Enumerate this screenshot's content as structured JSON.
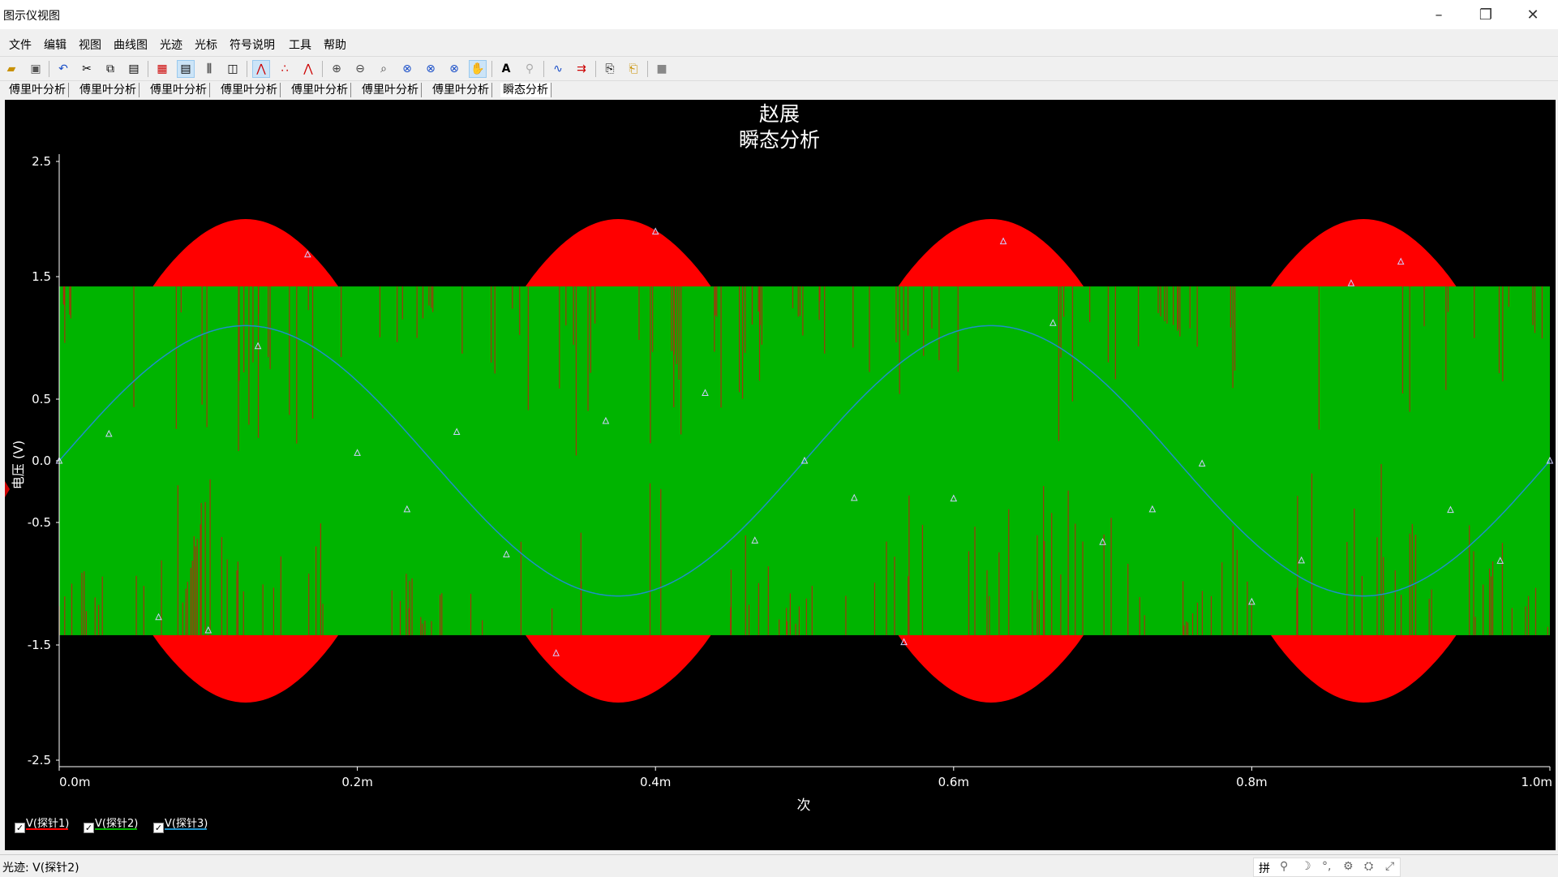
{
  "window": {
    "title": "图示仪视图"
  },
  "menu": [
    "文件",
    "编辑",
    "视图",
    "曲线图",
    "光迹",
    "光标",
    "符号说明",
    "工具",
    "帮助"
  ],
  "toolbar": {
    "icons": [
      "open-folder-icon",
      "save-icon",
      "undo-icon",
      "cut-icon",
      "copy-icon",
      "paste-icon",
      "grid-icon",
      "legend-icon",
      "chart-properties-icon",
      "overlay-icon",
      "toggle-cursors-icon",
      "select-marker-icon",
      "select-trace-icon",
      "zoom-in-icon",
      "zoom-out-icon",
      "zoom-area-icon",
      "zoom-x-icon",
      "zoom-y-icon",
      "zoom-full-icon",
      "pan-icon",
      "text-icon",
      "cursor-icon",
      "trace-icon",
      "export-icon",
      "copy-graph-icon",
      "paste-graph-icon",
      "stop-icon"
    ]
  },
  "tabs": [
    "傅里叶分析",
    "傅里叶分析",
    "傅里叶分析",
    "傅里叶分析",
    "傅里叶分析",
    "傅里叶分析",
    "傅里叶分析",
    "瞬态分析"
  ],
  "active_tab": 7,
  "colors": {
    "probe1": "#ff0000",
    "probe2": "#00b400",
    "probe3": "#1e90c8",
    "background": "#000000",
    "axes": "#ffffff"
  },
  "chart_data": {
    "type": "line",
    "title": "赵展",
    "subtitle": "瞬态分析",
    "xlabel": "次",
    "ylabel": "电压 (V)",
    "x_ticks": [
      "0.0m",
      "0.2m",
      "0.4m",
      "0.6m",
      "0.8m",
      "1.0m"
    ],
    "y_ticks": [
      "2.5",
      "1.5",
      "0.5",
      "0.0",
      "-0.5",
      "-1.5",
      "-2.5"
    ],
    "xlim": [
      0,
      0.001
    ],
    "ylim": [
      -2.5,
      2.5
    ],
    "series": [
      {
        "name": "V(探针1)",
        "color": "#ff0000",
        "kind": "modulated carrier",
        "envelope_peak": 2.0,
        "envelope_lobes": 8,
        "carrier_period_s": 2.5e-06
      },
      {
        "name": "V(探针2)",
        "color": "#00b400",
        "kind": "clipped carrier",
        "clip_level": 1.42
      },
      {
        "name": "V(探针3)",
        "color": "#1e90c8",
        "kind": "sine",
        "amplitude": 1.1,
        "frequency_hz": 2000,
        "phase_deg": 0
      }
    ]
  },
  "status": {
    "text": "光迹: V(探针2)"
  },
  "status_icons": [
    "grid-mode-icon",
    "ime-icon",
    "moon-icon",
    "punct-icon",
    "settings-icon",
    "skin-icon",
    "expand-icon"
  ]
}
